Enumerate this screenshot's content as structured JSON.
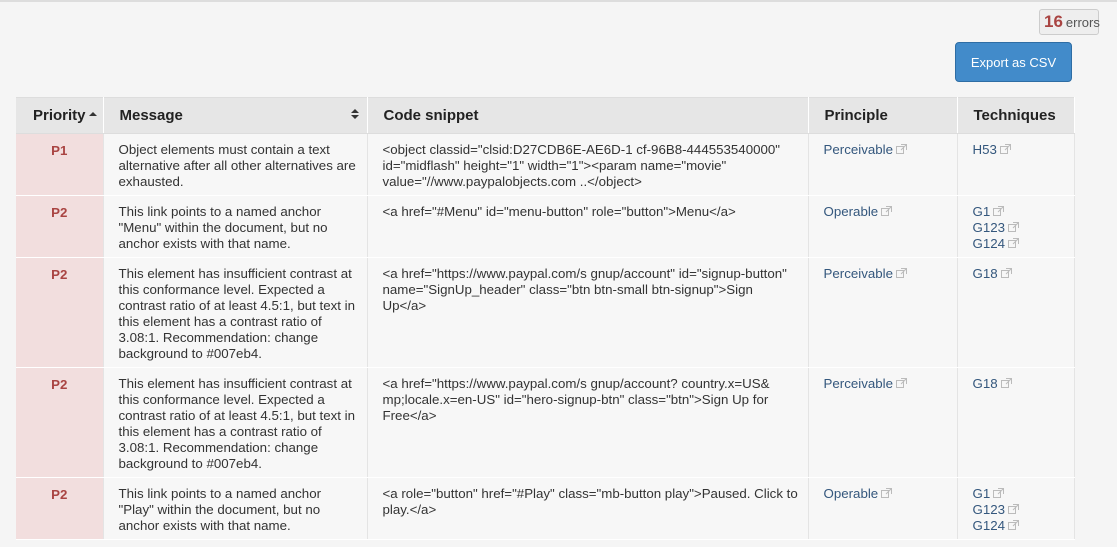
{
  "error_count": "16",
  "error_word": "errors",
  "export_label": "Export as CSV",
  "headers": {
    "priority": "Priority",
    "message": "Message",
    "code": "Code snippet",
    "principle": "Principle",
    "techniques": "Techniques"
  },
  "colors": {
    "priority_bg": "#f2dede",
    "priority_text": "#a94442",
    "button": "#428bca",
    "link": "#34577d"
  },
  "rows": [
    {
      "priority": "P1",
      "message": "Object elements must contain a text alternative after all other alternatives are exhausted.",
      "code": "<object classid=\"clsid:D27CDB6E-AE6D-1 cf-96B8-444553540000\" id=\"midflash\" height=\"1\" width=\"1\"><param name=\"movie\" value=\"//www.paypalobjects.com ..</object>",
      "principle": "Perceivable",
      "techniques": [
        "H53"
      ]
    },
    {
      "priority": "P2",
      "message": "This link points to a named anchor \"Menu\" within the document, but no anchor exists with that name.",
      "code": "<a href=\"#Menu\" id=\"menu-button\" role=\"button\">Menu</a>",
      "principle": "Operable",
      "techniques": [
        "G1",
        "G123",
        "G124"
      ]
    },
    {
      "priority": "P2",
      "message": "This element has insufficient contrast at this conformance level. Expected a contrast ratio of at least 4.5:1, but text in this element has a contrast ratio of 3.08:1. Recommendation: change background to #007eb4.",
      "code": "<a href=\"https://www.paypal.com/s gnup/account\" id=\"signup-button\" name=\"SignUp_header\" class=\"btn btn-small btn-signup\">Sign Up</a>",
      "principle": "Perceivable",
      "techniques": [
        "G18"
      ]
    },
    {
      "priority": "P2",
      "message": "This element has insufficient contrast at this conformance level. Expected a contrast ratio of at least 4.5:1, but text in this element has a contrast ratio of 3.08:1. Recommendation: change background to #007eb4.",
      "code": "<a href=\"https://www.paypal.com/s gnup/account? country.x=US& mp;locale.x=en-US\" id=\"hero-signup-btn\" class=\"btn\">Sign Up for Free</a>",
      "principle": "Perceivable",
      "techniques": [
        "G18"
      ]
    },
    {
      "priority": "P2",
      "message": "This link points to a named anchor \"Play\" within the document, but no anchor exists with that name.",
      "code": "<a role=\"button\" href=\"#Play\" class=\"mb-button play\">Paused. Click to play.</a>",
      "principle": "Operable",
      "techniques": [
        "G1",
        "G123",
        "G124"
      ]
    }
  ]
}
